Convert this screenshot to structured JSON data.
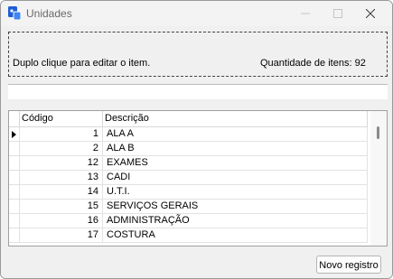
{
  "window": {
    "title": "Unidades",
    "icon": "app-icon",
    "controls": [
      "minimize-icon",
      "maximize-icon",
      "close-icon"
    ]
  },
  "info": {
    "hint": "Duplo clique para editar o item.",
    "count_label": "Quantidade de itens: 92"
  },
  "grid": {
    "columns": [
      "Código",
      "Descrição"
    ],
    "rows": [
      {
        "code": "1",
        "desc": "ALA A"
      },
      {
        "code": "2",
        "desc": "ALA B"
      },
      {
        "code": "12",
        "desc": "EXAMES"
      },
      {
        "code": "13",
        "desc": "CADI"
      },
      {
        "code": "14",
        "desc": "U.T.I."
      },
      {
        "code": "15",
        "desc": "SERVIÇOS GERAIS"
      },
      {
        "code": "16",
        "desc": "ADMINISTRAÇÃO"
      },
      {
        "code": "17",
        "desc": "COSTURA"
      }
    ],
    "selected_row": 0
  },
  "footer": {
    "new_button": "Novo registro"
  },
  "colors": {
    "window_bg": "#f0f0f0",
    "grid_bg": "#ffffff",
    "icon_blue": "#1f5fd6"
  }
}
